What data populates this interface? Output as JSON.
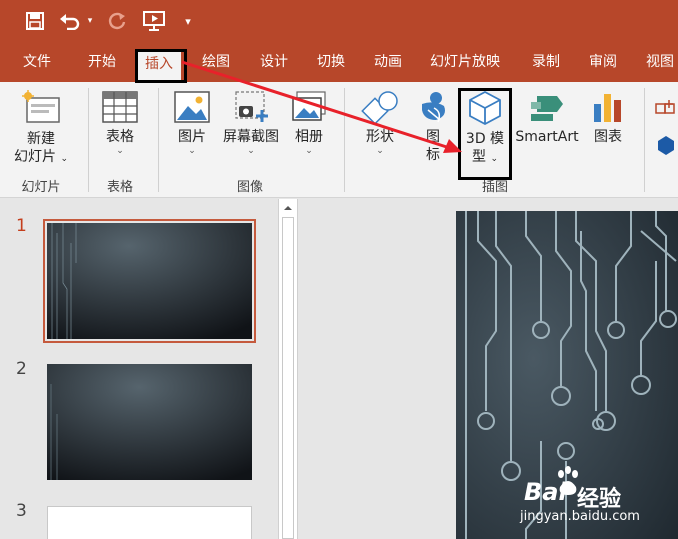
{
  "quick_access": {
    "save_icon": "save-icon",
    "undo_icon": "undo-icon",
    "undo_dropdown_icon": "chevron-down-icon",
    "redo_icon": "redo-icon",
    "present_icon": "slideshow-from-start-icon",
    "customize_icon": "customize-toolbar-icon"
  },
  "tabs": [
    {
      "label": "文件"
    },
    {
      "label": "开始"
    },
    {
      "label": "插入",
      "active": true
    },
    {
      "label": "绘图"
    },
    {
      "label": "设计"
    },
    {
      "label": "切换"
    },
    {
      "label": "动画"
    },
    {
      "label": "幻灯片放映"
    },
    {
      "label": "录制"
    },
    {
      "label": "审阅"
    },
    {
      "label": "视图"
    }
  ],
  "ribbon": {
    "groups": {
      "slides": "幻灯片",
      "tables": "表格",
      "images": "图像",
      "illustrations": "插图"
    },
    "buttons": {
      "new_slide_line1": "新建",
      "new_slide_line2": "幻灯片",
      "table": "表格",
      "picture": "图片",
      "screenshot": "屏幕截图",
      "album": "相册",
      "shapes": "形状",
      "icons_line1": "图",
      "icons_line2": "标",
      "model3d_line1": "3D 模",
      "model3d_line2": "型",
      "smartart": "SmartArt",
      "chart": "图表"
    }
  },
  "slides": [
    {
      "number": "1",
      "active": true
    },
    {
      "number": "2"
    },
    {
      "number": "3"
    }
  ],
  "watermark": {
    "brand": "Bai",
    "brand_text": "经验",
    "url": "jingyan.baidu.com"
  },
  "colors": {
    "accent": "#b7472a",
    "ribbon_bg": "#f3f3f3",
    "annotation_arrow": "#e8212a",
    "slide_bg": "#2d3a44"
  }
}
